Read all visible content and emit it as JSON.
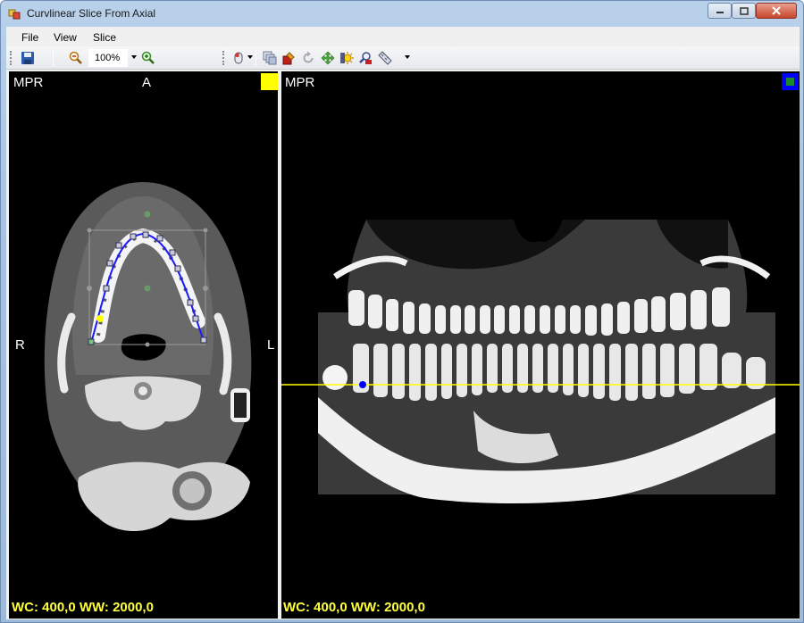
{
  "window": {
    "title": "Curvlinear Slice From Axial",
    "controls": [
      "minimize",
      "maximize",
      "close"
    ]
  },
  "menu": {
    "file": "File",
    "view": "View",
    "slice": "Slice"
  },
  "toolbar": {
    "zoom_value": "100%",
    "icons": [
      "save-icon",
      "zoom-out-icon",
      "zoom-in-icon",
      "mouse-mode-icon",
      "layers-icon",
      "paint-icon",
      "rotate-icon",
      "move-icon",
      "brightness-icon",
      "magnifier-icon",
      "ruler-icon"
    ]
  },
  "left_view": {
    "mode_label": "MPR",
    "orientation_top": "A",
    "orientation_left": "R",
    "orientation_right": "L",
    "window_level": "WC: 400,0 WW: 2000,0",
    "marker_color": "#ffff00"
  },
  "right_view": {
    "mode_label": "MPR",
    "window_level": "WC: 400,0 WW: 2000,0",
    "marker_color": "#0000ff",
    "slice_line_color": "#ffff00"
  }
}
